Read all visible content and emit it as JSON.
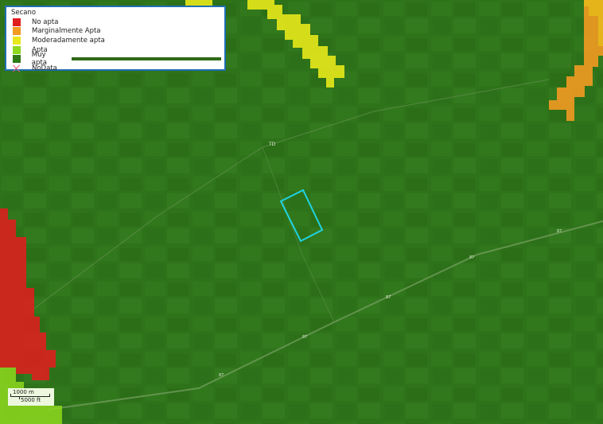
{
  "legend": {
    "title": "Secano",
    "items": [
      {
        "label": "No apta",
        "color": "#e01e1e"
      },
      {
        "label": "Marginalmente Apta",
        "color": "#f29a22"
      },
      {
        "label": "Moderadamente apta",
        "color": "#e8e81a"
      },
      {
        "label": "Apta",
        "color": "#8ed81e"
      },
      {
        "label": "Muy apta",
        "color": "#2e7a15"
      },
      {
        "label": "NoData",
        "color": "#e0607a"
      }
    ]
  },
  "scalebar": {
    "metric": "1000 m",
    "imperial": "5000 ft"
  },
  "road_labels": [
    "87",
    "87",
    "87",
    "87",
    "87"
  ],
  "town_label": "TD"
}
